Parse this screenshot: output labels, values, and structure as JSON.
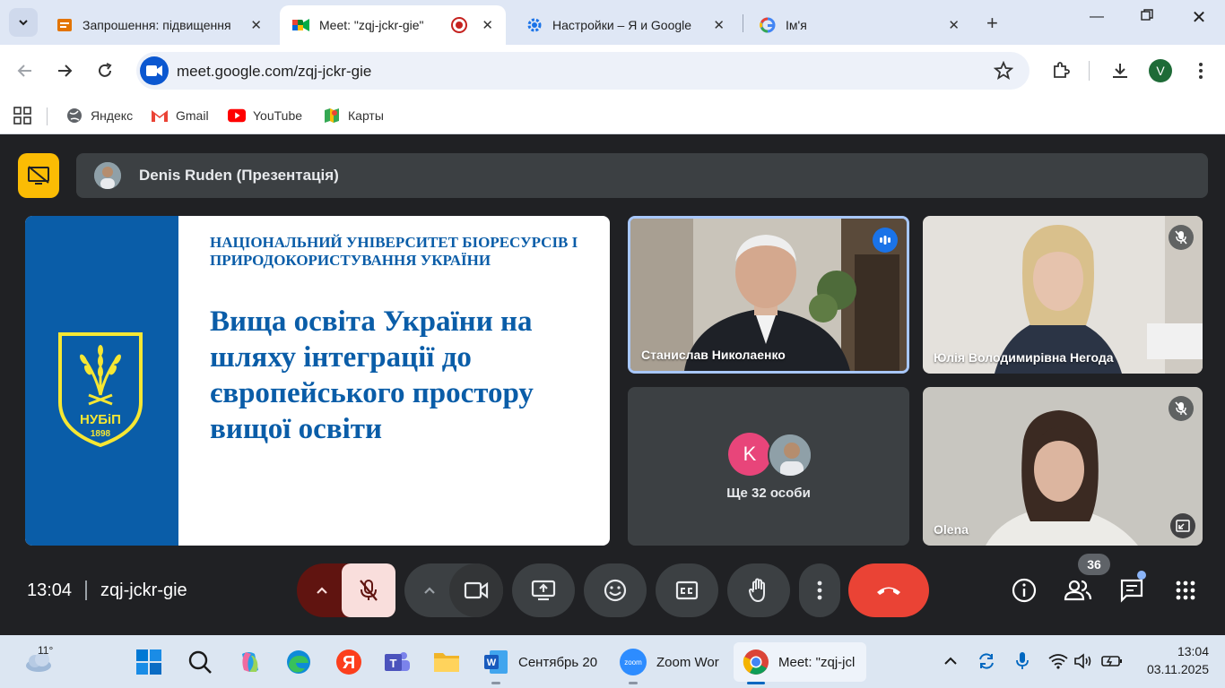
{
  "browser": {
    "tabs": [
      {
        "title": "Запрошення: підвищення"
      },
      {
        "title": "Meet: \"zqj-jckr-gie\""
      },
      {
        "title": "Настройки – Я и Google"
      },
      {
        "title": "Ім'я"
      }
    ],
    "url": "meet.google.com/zqj-jckr-gie",
    "profile_initial": "V",
    "bookmarks": [
      {
        "label": "Яндекс"
      },
      {
        "label": "Gmail"
      },
      {
        "label": "YouTube"
      },
      {
        "label": "Карты"
      }
    ]
  },
  "meet": {
    "presenter": "Denis Ruden (Презентація)",
    "slide": {
      "university": "НАЦІОНАЛЬНИЙ УНІВЕРСИТЕТ БІОРЕСУРСІВ І ПРИРОДОКОРИСТУВАННЯ УКРАЇНИ",
      "headline": "Вища освіта України на шляху інтеграції до європейського простору вищої освіти",
      "crest_text": "НУБіП",
      "crest_year": "1898"
    },
    "participants": [
      {
        "name": "Станислав Николаенко",
        "speaking": true
      },
      {
        "name": "Юлія Володимирівна Негода",
        "muted": true
      },
      {
        "name": "Olena",
        "muted": true
      }
    ],
    "more": {
      "initial": "K",
      "label": "Ще 32 особи"
    },
    "time": "13:04",
    "meeting_code": "zqj-jckr-gie",
    "participant_count": "36",
    "colors": {
      "end_call": "#ea4335",
      "mic_off_bg": "#f9dedc",
      "mic_arrow_bg": "#601410",
      "present_yellow": "#fbbc04"
    }
  },
  "taskbar": {
    "temperature": "11°",
    "apps": [
      {
        "label": "Сентябрь 20"
      },
      {
        "label": "Zoom Wor"
      },
      {
        "label": "Meet: \"zqj-jcl"
      }
    ],
    "time": "13:04",
    "date": "03.11.2025"
  }
}
